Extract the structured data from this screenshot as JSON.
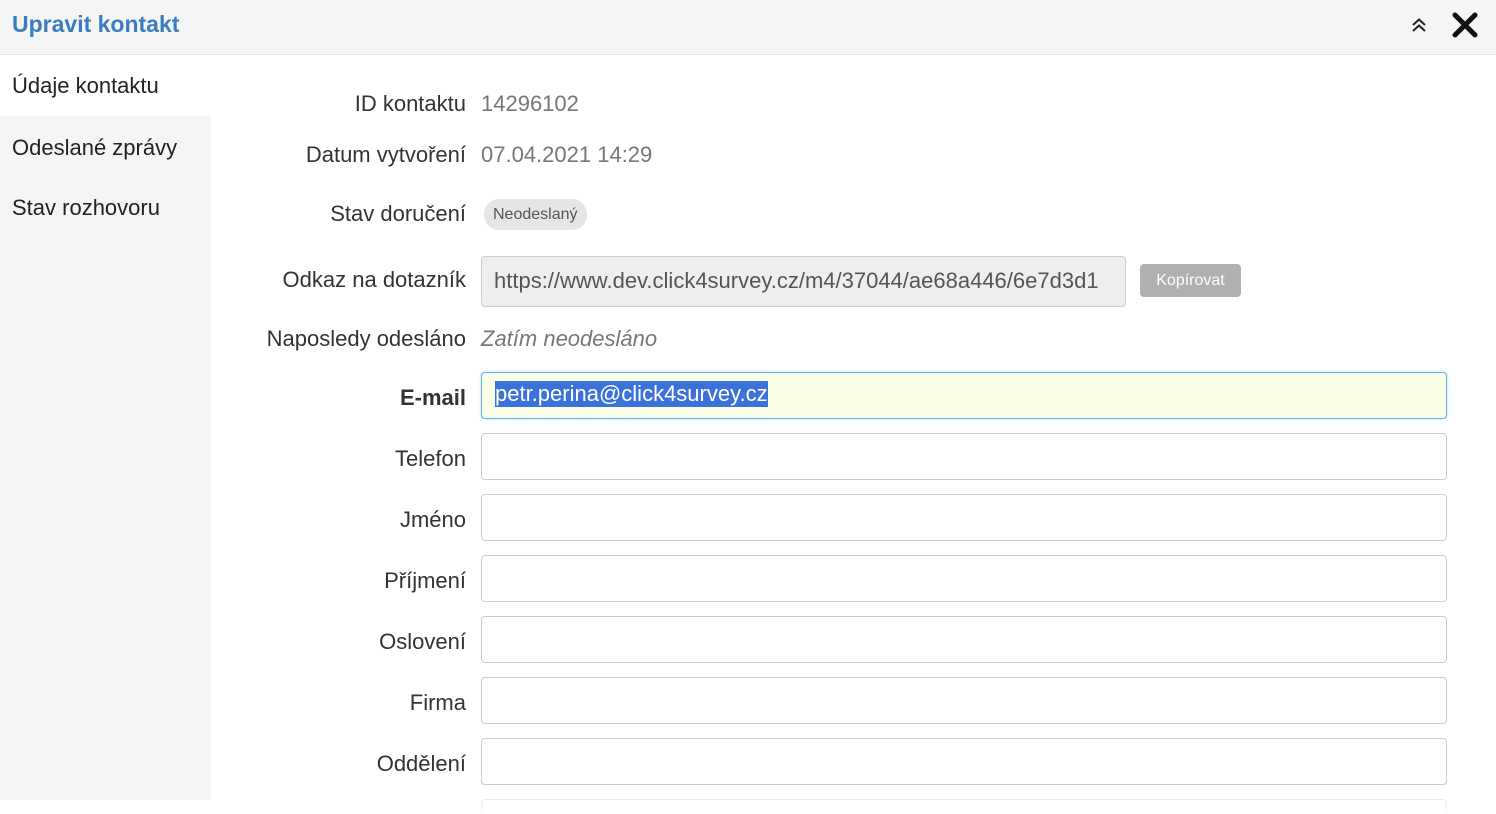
{
  "header": {
    "title": "Upravit kontakt",
    "collapse_icon": "double-chevron-up-icon",
    "close_icon": "close-icon"
  },
  "sidebar": {
    "items": [
      {
        "label": "Údaje kontaktu",
        "active": true
      },
      {
        "label": "Odeslané zprávy",
        "active": false
      },
      {
        "label": "Stav rozhovoru",
        "active": false
      }
    ]
  },
  "info": {
    "id_label": "ID kontaktu",
    "id_value": "14296102",
    "created_label": "Datum vytvoření",
    "created_value": "07.04.2021 14:29",
    "delivery_label": "Stav doručení",
    "delivery_value": "Neodeslaný",
    "link_label": "Odkaz na dotazník",
    "link_value": "https://www.dev.click4survey.cz/m4/37044/ae68a446/6e7d3d1",
    "copy_label": "Kopírovat",
    "last_sent_label": "Naposledy odesláno",
    "last_sent_value": "Zatím neodesláno"
  },
  "fields": {
    "email_label": "E-mail",
    "email_value": "petr.perina@click4survey.cz",
    "phone_label": "Telefon",
    "phone_value": "",
    "first_name_label": "Jméno",
    "first_name_value": "",
    "last_name_label": "Příjmení",
    "last_name_value": "",
    "salutation_label": "Oslovení",
    "salutation_value": "",
    "company_label": "Firma",
    "company_value": "",
    "department_label": "Oddělení",
    "department_value": ""
  },
  "colors": {
    "accent": "#3a7ebf",
    "header_bg": "#f5f5f5",
    "selection": "#3b72d9",
    "autofill_bg": "#fafee6",
    "button_gray": "#b0b0b0"
  }
}
